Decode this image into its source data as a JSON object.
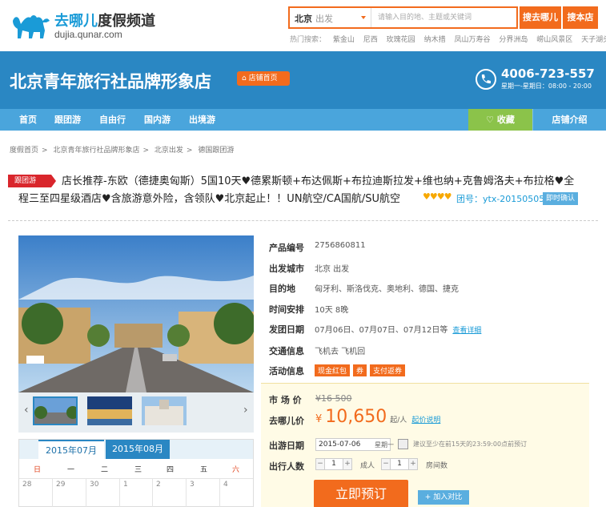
{
  "header": {
    "logo_text": "去哪儿",
    "logo_text2": "度假频道",
    "logo_sub": "dujia.qunar.com",
    "city": "北京",
    "city_sub": "出发",
    "search_placeholder": "请输入目的地、主题或关键词",
    "search_button": "搜去哪儿",
    "search_shop_button": "搜本店",
    "hot_label": "热门搜索：",
    "hot_terms": [
      "紫金山",
      "尼西",
      "玫瑰花园",
      "纳木措",
      "凤山万寿谷",
      "分界洲岛",
      "崂山风景区",
      "天子湖头"
    ]
  },
  "shop": {
    "name": "北京青年旅行社品牌形象店",
    "home_label": "店铺首页",
    "phone": "4006-723-557",
    "hours": "星期一-星期日：08:00 - 20:00"
  },
  "nav": {
    "items": [
      "首页",
      "跟团游",
      "自由行",
      "国内游",
      "出境游"
    ],
    "favorite": "收藏",
    "shop_intro": "店铺介绍"
  },
  "breadcrumb": [
    "度假首页",
    "北京青年旅行社品牌形象店",
    "北京出发",
    "德国跟团游"
  ],
  "product": {
    "tag": "跟团游",
    "title_line1": "店长推荐-东欧（德捷奥匈斯）5国10天♥德累斯顿+布达佩斯+布拉迪斯拉发+维也纳+克鲁姆洛夫+布拉格♥全",
    "title_line2": "程三至四星级酒店♥含旅游意外险，含领队♥北京起止！！UN航空/CA国航/SU航空",
    "stars": "♥♥♥♥",
    "group_no": "团号：ytx-20150505",
    "instant_confirm": "即时确认",
    "fields": [
      {
        "label": "产品编号",
        "value": "2756860811"
      },
      {
        "label": "出发城市",
        "value": "北京 出发"
      },
      {
        "label": "目的地",
        "value": "匈牙利、斯洛伐克、奥地利、德国、捷克"
      },
      {
        "label": "时间安排",
        "value": "10天 8晚"
      },
      {
        "label": "发团日期",
        "value": "07月06日、07月07日、07月12日等",
        "link": "查看详细"
      },
      {
        "label": "交通信息",
        "value": "飞机去 飞机回"
      },
      {
        "label": "活动信息",
        "badges": [
          "现金红包",
          "券",
          "支付返券"
        ]
      }
    ]
  },
  "price": {
    "market_label": "市 场 价",
    "market_value": "¥16 500",
    "qunar_label": "去哪儿价",
    "currency": "¥",
    "qunar_value": "10,650",
    "unit": "起/人",
    "explain": "起价说明",
    "date_label": "出游日期",
    "date_value": "2015-07-06",
    "weekday": "星期一",
    "hint": "建议至少在前15天的23:59:00点前预订",
    "people_label": "出行人数",
    "adults": "1",
    "adults_label": "成人",
    "rooms": "1",
    "rooms_label": "房间数",
    "book": "立即预订",
    "compare": "+ 加入对比"
  },
  "calendar": {
    "tabs": [
      "2015年07月",
      "2015年08月"
    ],
    "weekdays": [
      "日",
      "一",
      "二",
      "三",
      "四",
      "五",
      "六"
    ],
    "dates": [
      "28",
      "29",
      "30",
      "1",
      "2",
      "3",
      "4"
    ]
  },
  "colors": {
    "brand_blue": "#2a87c3",
    "nav_blue": "#4aa5dc",
    "orange": "#f26b1d",
    "green": "#8bc34a"
  }
}
